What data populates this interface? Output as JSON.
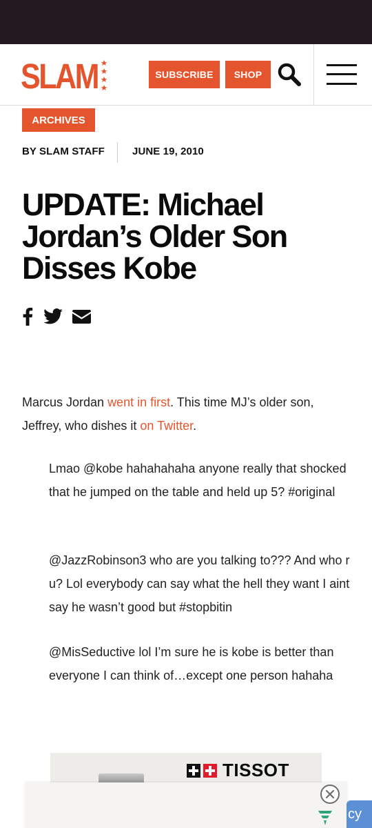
{
  "header": {
    "logo_text": "SLAM",
    "subscribe_label": "SUBSCRIBE",
    "shop_label": "SHOP"
  },
  "article": {
    "category": "ARCHIVES",
    "byline": "BY SLAM STAFF",
    "date": "JUNE 19, 2010",
    "title": "UPDATE: Michael Jordan’s Older Son Disses Kobe",
    "lead": {
      "part1": "Marcus Jordan ",
      "link1": "went in first",
      "part2": ". This time MJ’s older son, Jeffrey, who dishes it ",
      "link2": "on Twitter",
      "part3": "."
    },
    "quotes": [
      "Lmao @kobe hahahahaha anyone really that shocked that he jumped on the table and held up 5? #original",
      "@JazzRobinson3 who are you talking to??? And who r u? Lol everybody can say what the hell they want I aint say he wasn’t good but #stopbitin",
      "@MisSeductive lol I’m sure he is kobe is better than everyone I can think of…except one person hahaha"
    ]
  },
  "ad": {
    "brand": "TISSOT",
    "privacy_label": "cy"
  },
  "colors": {
    "accent": "#e5552d",
    "status_bar": "#231a1f",
    "privacy_tab": "#5b8fd6"
  },
  "icons": [
    "facebook-icon",
    "twitter-icon",
    "email-icon",
    "search-icon",
    "hamburger-menu-icon",
    "close-icon"
  ]
}
